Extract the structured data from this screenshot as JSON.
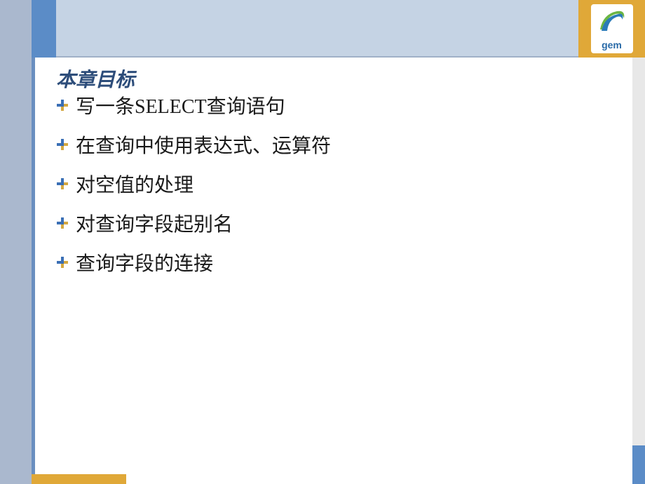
{
  "logo": {
    "text": "gem"
  },
  "title": "本章目标",
  "bullets": [
    "写一条SELECT查询语句",
    "在查询中使用表达式、运算符",
    "对空值的处理",
    "对查询字段起别名",
    "查询字段的连接"
  ]
}
